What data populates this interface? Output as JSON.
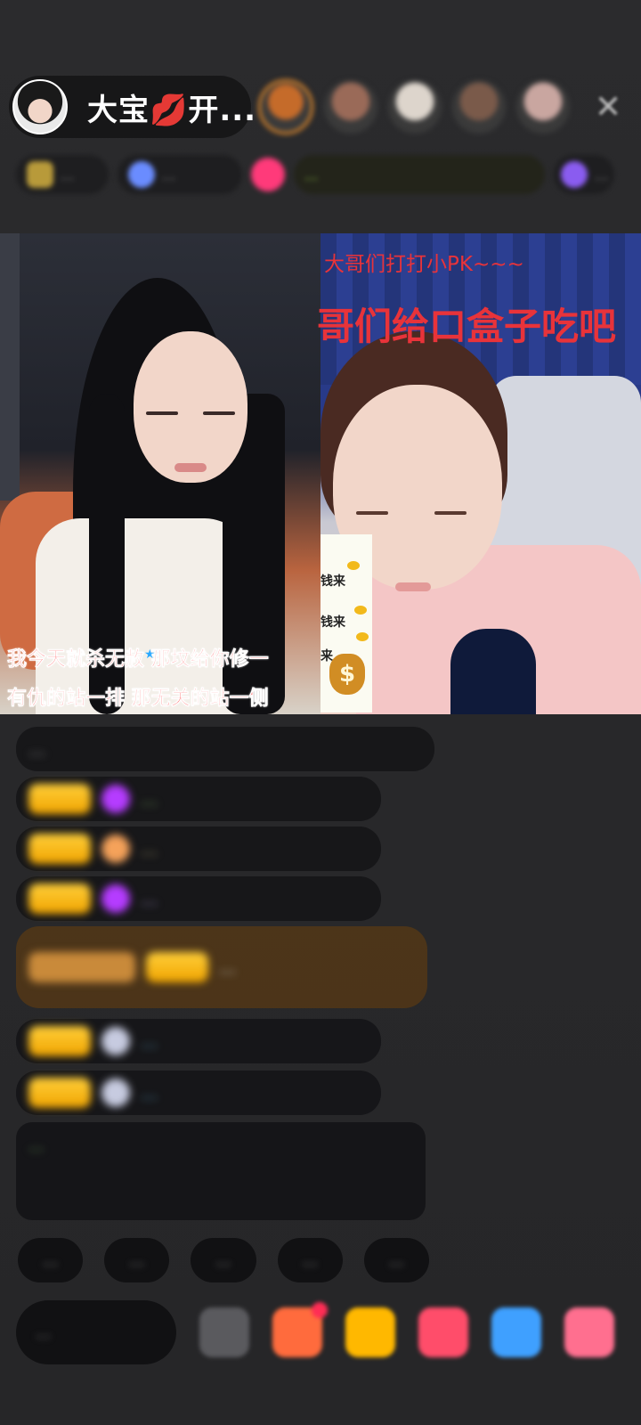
{
  "header": {
    "host_name": "大宝",
    "host_suffix": "开...",
    "host_emoji": "💋",
    "close_icon_glyph": "✕",
    "viewer_avatars": [
      {
        "name": "viewer-avatar-1",
        "color": "#c56b2a"
      },
      {
        "name": "viewer-avatar-2",
        "color": "#9a6a58"
      },
      {
        "name": "viewer-avatar-3",
        "color": "#ddd5cc"
      },
      {
        "name": "viewer-avatar-4",
        "color": "#7a5a4a"
      },
      {
        "name": "viewer-avatar-5",
        "color": "#c9a6a0"
      }
    ]
  },
  "info_bar": {
    "chips": [
      "...",
      "...",
      "...",
      "..."
    ]
  },
  "video": {
    "left_subtitle_line1": "我今天就杀无赦 那坟给你修一",
    "left_subtitle_line2": "有仇的站一排 那无关的站一侧",
    "right_banner_line1": "大哥们打打小PK~~~",
    "right_banner_line2": "哥们给口盒子吃吧",
    "money_box": {
      "lines": [
        "钱来",
        "钱来",
        "来"
      ],
      "bag_symbol": "$"
    }
  },
  "chat": {
    "messages": [
      {
        "text": "...",
        "type": "plain"
      },
      {
        "text": "...",
        "type": "user",
        "gem": "#b53cff"
      },
      {
        "text": "...",
        "type": "user",
        "gem": "#f5a25a"
      },
      {
        "text": "...",
        "type": "user",
        "gem": "#b53cff"
      },
      {
        "text": "...",
        "type": "highlight"
      },
      {
        "text": "...",
        "type": "user",
        "gem": "#c7cbe0"
      },
      {
        "text": "...",
        "type": "user",
        "gem": "#c7cbe0"
      },
      {
        "text": "...",
        "type": "system"
      }
    ]
  },
  "quick_replies": [
    "...",
    "...",
    "...",
    "...",
    "...",
    "..."
  ],
  "bottom_bar": {
    "input_placeholder": "...",
    "buttons": [
      {
        "name": "more-icon",
        "color": "#5a5a5e"
      },
      {
        "name": "gift-icon",
        "color": "#ff6b3d"
      },
      {
        "name": "treasure-icon",
        "color": "#ffb800"
      },
      {
        "name": "heart-icon",
        "color": "#ff4d6a"
      },
      {
        "name": "game-icon",
        "color": "#3fa0ff"
      },
      {
        "name": "shop-icon",
        "color": "#ff6f8f"
      }
    ]
  },
  "colors": {
    "background": "#2a2a2c",
    "level_badge": "#f0a400",
    "subtitle_red": "#e8333a"
  }
}
